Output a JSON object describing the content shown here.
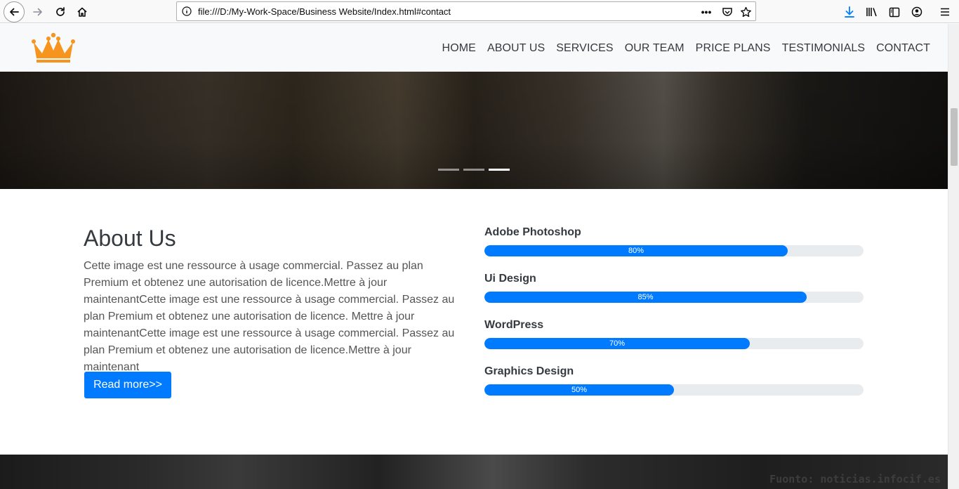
{
  "browser": {
    "url": "file:///D:/My-Work-Space/Business Website/Index.html#contact",
    "page_actions_icon": "•••"
  },
  "nav": {
    "items": [
      {
        "label": "HOME"
      },
      {
        "label": "ABOUT US"
      },
      {
        "label": "SERVICES"
      },
      {
        "label": "OUR TEAM"
      },
      {
        "label": "PRICE PLANS"
      },
      {
        "label": "TESTIMONIALS"
      },
      {
        "label": "CONTACT"
      }
    ]
  },
  "carousel": {
    "slide_count": 3,
    "active_index": 2
  },
  "about": {
    "title": "About Us",
    "text": "Cette image est une ressource à usage commercial. Passez au plan Premium et obtenez une autorisation de licence.Mettre à jour maintenantCette image est une ressource à usage commercial. Passez au plan Premium et obtenez une autorisation de licence. Mettre à jour maintenantCette image est une ressource à usage commercial. Passez au plan Premium et obtenez une autorisation de licence.Mettre à jour maintenant",
    "button_label": "Read more>>"
  },
  "skills": [
    {
      "name": "Adobe Photoshop",
      "percent": 80,
      "label": "80%"
    },
    {
      "name": "Ui Design",
      "percent": 85,
      "label": "85%"
    },
    {
      "name": "WordPress",
      "percent": 70,
      "label": "70%"
    },
    {
      "name": "Graphics Design",
      "percent": 50,
      "label": "50%"
    }
  ],
  "watermark": "Fuonto: noticias.infocif.es",
  "colors": {
    "primary": "#007bff",
    "logo": "#f7941d",
    "nav_text": "#343a40",
    "download_icon": "#0a84ff"
  }
}
